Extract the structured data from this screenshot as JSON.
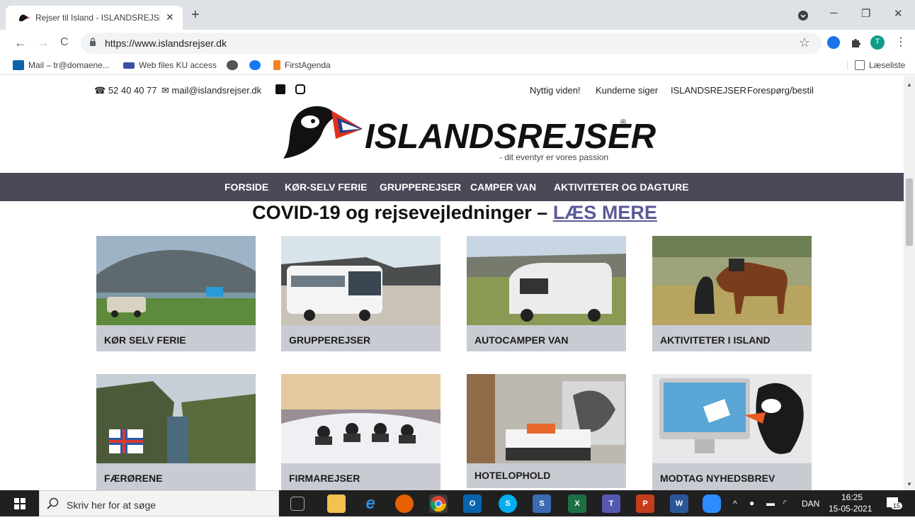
{
  "browser": {
    "tab_title": "Rejser til Island - ISLANDSREJSER",
    "tab_close": "✕",
    "new_tab": "+",
    "url": "https://www.islandsrejser.dk",
    "window_controls": {
      "minimize": "─",
      "restore": "❐",
      "close": "✕"
    },
    "nav": {
      "back": "←",
      "forward": "→",
      "reload": "C"
    },
    "profile_initial": "T",
    "star": "☆",
    "menu": "⋮",
    "bookmarks": [
      {
        "label": "Mail – tr@domaene...",
        "icon": "outlook-icon"
      },
      {
        "label": "Web files KU access",
        "icon": "webfiles-icon"
      },
      {
        "label": "",
        "icon": "globe-icon"
      },
      {
        "label": "",
        "icon": "facebook-icon"
      },
      {
        "label": "FirstAgenda",
        "icon": "bookmark-icon"
      }
    ],
    "reading_list": "Læseliste"
  },
  "site": {
    "phone": "52 40 40 77",
    "email": "mail@islandsrejser.dk",
    "top_links": [
      "Nyttig viden!",
      "Kunderne siger",
      "ISLANDSREJSER",
      "Forespørg/bestil"
    ],
    "logo_text": "ISLANDSREJSER",
    "logo_reg": "®",
    "tagline": "- dit eventyr er vores passion",
    "nav": [
      "FORSIDE",
      "KØR-SELV FERIE",
      "GRUPPEREJSER",
      "CAMPER VAN",
      "AKTIVITETER OG DAGTURE"
    ],
    "covid_text": "COVID-19 og rejsevejledninger – ",
    "covid_link": "LÆS MERE",
    "cards": [
      {
        "label": "KØR SELV FERIE"
      },
      {
        "label": "GRUPPEREJSER"
      },
      {
        "label": "AUTOCAMPER VAN"
      },
      {
        "label": "AKTIVITETER I ISLAND"
      },
      {
        "label": "FÆRØRENE"
      },
      {
        "label": "FIRMAREJSER"
      },
      {
        "label": "HOTELOPHOLD"
      },
      {
        "label": "MODTAG NYHEDSBREV"
      }
    ]
  },
  "taskbar": {
    "search_placeholder": "Skriv her for at søge",
    "language": "DAN",
    "time": "16:25",
    "date": "15-05-2021",
    "notifications": "15",
    "tray_chevron": "^"
  }
}
